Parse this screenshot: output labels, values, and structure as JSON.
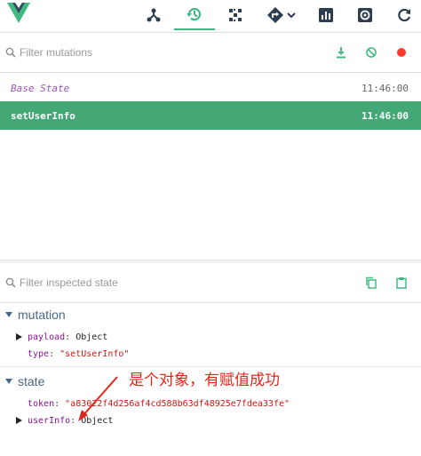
{
  "toolbar": {
    "icons": [
      "vue-logo-icon",
      "components-icon",
      "history-icon",
      "vuex-icon",
      "routing-icon",
      "performance-icon",
      "settings-icon",
      "refresh-icon"
    ],
    "accent_color": "#42b983"
  },
  "mutations": {
    "filter_placeholder": "Filter mutations",
    "items": [
      {
        "name": "Base State",
        "time": "11:46:00"
      },
      {
        "name": "setUserInfo",
        "time": "11:46:00"
      }
    ],
    "selected_color": "#44a776"
  },
  "inspector": {
    "filter_placeholder": "Filter inspected state",
    "mutation_section": {
      "title": "mutation",
      "props": [
        {
          "key": "payload",
          "value": "Object"
        },
        {
          "key": "type",
          "value": "\"setUserInfo\""
        }
      ]
    },
    "state_section": {
      "title": "state",
      "props": [
        {
          "key": "token",
          "value": "\"a83022f4d256af4cd588b63df48925e7fdea33fe\""
        },
        {
          "key": "userInfo",
          "value": "Object"
        }
      ]
    }
  },
  "annotation": {
    "text": "是个对象，有赋值成功",
    "color": "#e0281a"
  }
}
